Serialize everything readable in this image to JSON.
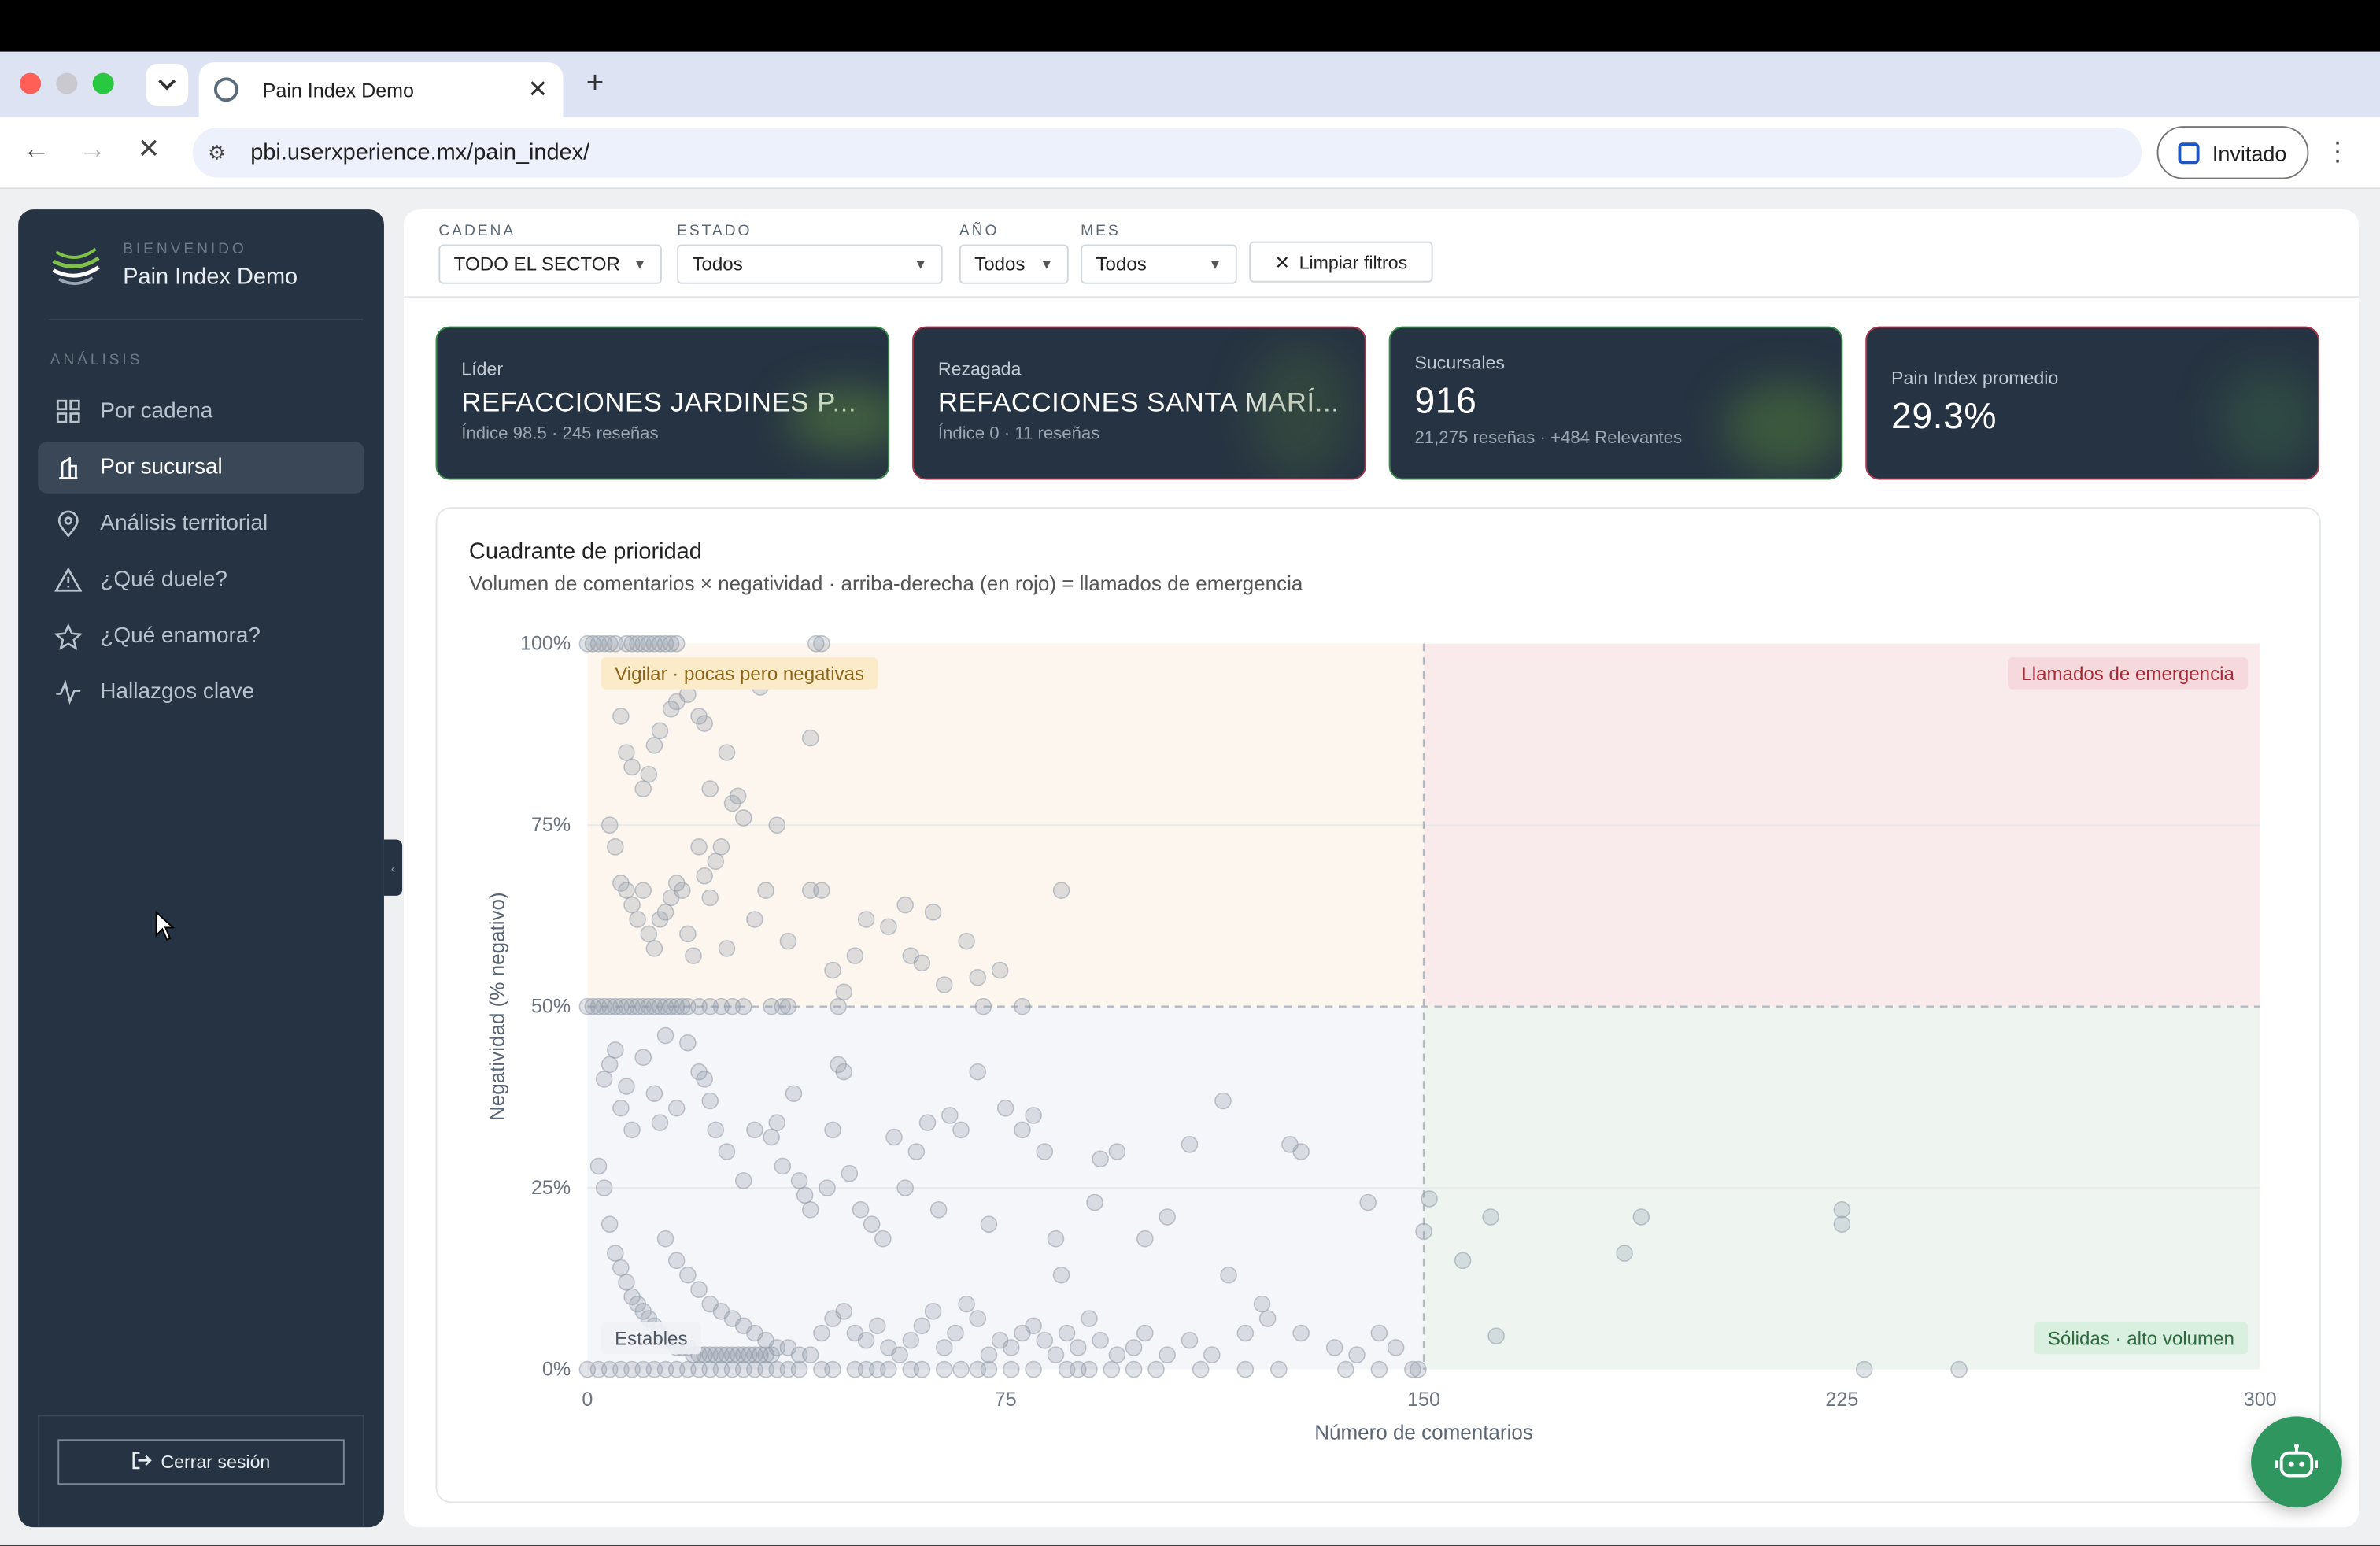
{
  "browser": {
    "tab_title": "Pain Index Demo",
    "url": "pbi.userxperience.mx/pain_index/",
    "profile_label": "Invitado"
  },
  "sidebar": {
    "welcome": "BIENVENIDO",
    "brand": "Pain Index Demo",
    "section": "ANÁLISIS",
    "items": [
      {
        "label": "Por cadena",
        "icon": "grid-icon"
      },
      {
        "label": "Por sucursal",
        "icon": "building-icon",
        "active": true
      },
      {
        "label": "Análisis territorial",
        "icon": "map-pin-icon"
      },
      {
        "label": "¿Qué duele?",
        "icon": "warning-icon"
      },
      {
        "label": "¿Qué enamora?",
        "icon": "star-icon"
      },
      {
        "label": "Hallazgos clave",
        "icon": "activity-icon"
      }
    ],
    "logout": "Cerrar sesión"
  },
  "filters": {
    "cadena": {
      "label": "CADENA",
      "value": "TODO EL SECTOR"
    },
    "estado": {
      "label": "ESTADO",
      "value": "Todos"
    },
    "anio": {
      "label": "AÑO",
      "value": "Todos"
    },
    "mes": {
      "label": "MES",
      "value": "Todos"
    },
    "clear": "Limpiar filtros"
  },
  "kpis": [
    {
      "label": "Líder",
      "value": "REFACCIONES JARDINES P...",
      "sub": "Índice 98.5 · 245 reseñas",
      "accent": "#3b8a4c"
    },
    {
      "label": "Rezagada",
      "value": "REFACCIONES SANTA MARÍ...",
      "sub": "Índice 0 · 11 reseñas",
      "accent": "#a3364a"
    },
    {
      "label": "Sucursales",
      "value": "916",
      "sub": "21,275 reseñas · +484 Relevantes",
      "accent": "#3b8a4c"
    },
    {
      "label": "Pain Index promedio",
      "value": "29.3%",
      "sub": "",
      "accent": "#a3364a"
    }
  ],
  "quadrant": {
    "title": "Cuadrante de prioridad",
    "subtitle": "Volumen de comentarios × negatividad · arriba-derecha (en rojo) = llamados de emergencia"
  },
  "chart_data": {
    "type": "scatter",
    "xlabel": "Número de comentarios",
    "ylabel": "Negatividad (% negativo)",
    "xlim": [
      0,
      300
    ],
    "ylim": [
      0,
      100
    ],
    "x_ticks": [
      "0",
      "75",
      "150",
      "225",
      "300"
    ],
    "y_ticks": [
      "0%",
      "25%",
      "50%",
      "75%",
      "100%"
    ],
    "thresholds": {
      "x": 150,
      "y": 50
    },
    "quadrant_labels": {
      "top_left": "Vigilar · pocas pero negativas",
      "top_right": "Llamados de emergencia",
      "bottom_left": "Estables",
      "bottom_right": "Sólidas · alto volumen"
    },
    "colors": {
      "top_left": "#fdf6ee",
      "top_right": "#f9ebec",
      "bottom_left": "#f4f6f9",
      "bottom_right": "#eef5f0",
      "point": "#8f9aa9"
    },
    "points": [
      [
        0,
        100
      ],
      [
        1,
        100
      ],
      [
        2,
        100
      ],
      [
        3,
        100
      ],
      [
        4,
        100
      ],
      [
        5,
        100
      ],
      [
        7,
        100
      ],
      [
        8,
        100
      ],
      [
        9,
        100
      ],
      [
        10,
        100
      ],
      [
        11,
        100
      ],
      [
        12,
        100
      ],
      [
        13,
        100
      ],
      [
        14,
        100
      ],
      [
        15,
        100
      ],
      [
        16,
        100
      ],
      [
        41,
        100
      ],
      [
        42,
        100
      ],
      [
        6,
        90
      ],
      [
        7,
        85
      ],
      [
        8,
        83
      ],
      [
        10,
        80
      ],
      [
        11,
        82
      ],
      [
        12,
        86
      ],
      [
        13,
        88
      ],
      [
        15,
        91
      ],
      [
        16,
        92
      ],
      [
        18,
        93
      ],
      [
        20,
        90
      ],
      [
        21,
        89
      ],
      [
        22,
        80
      ],
      [
        25,
        85
      ],
      [
        31,
        94
      ],
      [
        40,
        87
      ],
      [
        4,
        75
      ],
      [
        5,
        72
      ],
      [
        6,
        67
      ],
      [
        7,
        66
      ],
      [
        8,
        64
      ],
      [
        9,
        62
      ],
      [
        10,
        66
      ],
      [
        11,
        60
      ],
      [
        12,
        58
      ],
      [
        13,
        62
      ],
      [
        14,
        63
      ],
      [
        15,
        65
      ],
      [
        16,
        67
      ],
      [
        17,
        66
      ],
      [
        18,
        60
      ],
      [
        19,
        57
      ],
      [
        20,
        72
      ],
      [
        21,
        68
      ],
      [
        22,
        65
      ],
      [
        23,
        70
      ],
      [
        24,
        72
      ],
      [
        25,
        58
      ],
      [
        26,
        78
      ],
      [
        27,
        79
      ],
      [
        28,
        76
      ],
      [
        30,
        62
      ],
      [
        32,
        66
      ],
      [
        34,
        75
      ],
      [
        36,
        59
      ],
      [
        40,
        66
      ],
      [
        42,
        66
      ],
      [
        44,
        55
      ],
      [
        48,
        57
      ],
      [
        50,
        62
      ],
      [
        54,
        61
      ],
      [
        57,
        64
      ],
      [
        58,
        57
      ],
      [
        60,
        56
      ],
      [
        62,
        63
      ],
      [
        64,
        53
      ],
      [
        68,
        59
      ],
      [
        70,
        54
      ],
      [
        71,
        50
      ],
      [
        74,
        55
      ],
      [
        85,
        66
      ],
      [
        0,
        50
      ],
      [
        1,
        50
      ],
      [
        2,
        50
      ],
      [
        3,
        50
      ],
      [
        4,
        50
      ],
      [
        5,
        50
      ],
      [
        6,
        50
      ],
      [
        7,
        50
      ],
      [
        8,
        50
      ],
      [
        9,
        50
      ],
      [
        10,
        50
      ],
      [
        11,
        50
      ],
      [
        12,
        50
      ],
      [
        13,
        50
      ],
      [
        14,
        50
      ],
      [
        15,
        50
      ],
      [
        16,
        50
      ],
      [
        17,
        50
      ],
      [
        18,
        50
      ],
      [
        20,
        50
      ],
      [
        22,
        50
      ],
      [
        24,
        50
      ],
      [
        26,
        50
      ],
      [
        28,
        50
      ],
      [
        33,
        50
      ],
      [
        35,
        50
      ],
      [
        36,
        50
      ],
      [
        45,
        50
      ],
      [
        46,
        52
      ],
      [
        78,
        50
      ],
      [
        3,
        40
      ],
      [
        4,
        42
      ],
      [
        5,
        44
      ],
      [
        6,
        36
      ],
      [
        7,
        39
      ],
      [
        8,
        33
      ],
      [
        10,
        43
      ],
      [
        12,
        38
      ],
      [
        13,
        34
      ],
      [
        14,
        46
      ],
      [
        16,
        36
      ],
      [
        18,
        45
      ],
      [
        20,
        41
      ],
      [
        21,
        40
      ],
      [
        22,
        37
      ],
      [
        23,
        33
      ],
      [
        25,
        30
      ],
      [
        28,
        26
      ],
      [
        30,
        33
      ],
      [
        33,
        32
      ],
      [
        34,
        34
      ],
      [
        35,
        28
      ],
      [
        37,
        38
      ],
      [
        38,
        26
      ],
      [
        39,
        24
      ],
      [
        40,
        22
      ],
      [
        43,
        25
      ],
      [
        44,
        33
      ],
      [
        45,
        42
      ],
      [
        46,
        41
      ],
      [
        47,
        27
      ],
      [
        49,
        22
      ],
      [
        51,
        20
      ],
      [
        53,
        18
      ],
      [
        55,
        32
      ],
      [
        57,
        25
      ],
      [
        59,
        30
      ],
      [
        61,
        34
      ],
      [
        63,
        22
      ],
      [
        65,
        35
      ],
      [
        67,
        33
      ],
      [
        70,
        41
      ],
      [
        72,
        20
      ],
      [
        75,
        36
      ],
      [
        78,
        33
      ],
      [
        80,
        35
      ],
      [
        82,
        30
      ],
      [
        84,
        18
      ],
      [
        85,
        13
      ],
      [
        91,
        23
      ],
      [
        92,
        29
      ],
      [
        95,
        30
      ],
      [
        100,
        18
      ],
      [
        104,
        21
      ],
      [
        108,
        31
      ],
      [
        114,
        37
      ],
      [
        115,
        13
      ],
      [
        126,
        31
      ],
      [
        128,
        30
      ],
      [
        140,
        23
      ],
      [
        150,
        19
      ],
      [
        2,
        28
      ],
      [
        3,
        25
      ],
      [
        4,
        20
      ],
      [
        5,
        16
      ],
      [
        6,
        14
      ],
      [
        7,
        12
      ],
      [
        8,
        10
      ],
      [
        9,
        9
      ],
      [
        10,
        8
      ],
      [
        11,
        7
      ],
      [
        12,
        6
      ],
      [
        13,
        5
      ],
      [
        14,
        4
      ],
      [
        15,
        4
      ],
      [
        16,
        3
      ],
      [
        17,
        3
      ],
      [
        18,
        3
      ],
      [
        19,
        2
      ],
      [
        20,
        2
      ],
      [
        21,
        2
      ],
      [
        22,
        2
      ],
      [
        23,
        2
      ],
      [
        24,
        2
      ],
      [
        25,
        2
      ],
      [
        26,
        2
      ],
      [
        27,
        2
      ],
      [
        28,
        2
      ],
      [
        29,
        2
      ],
      [
        30,
        2
      ],
      [
        31,
        2
      ],
      [
        32,
        2
      ],
      [
        33,
        2
      ],
      [
        14,
        18
      ],
      [
        16,
        15
      ],
      [
        18,
        13
      ],
      [
        20,
        11
      ],
      [
        22,
        9
      ],
      [
        24,
        8
      ],
      [
        26,
        7
      ],
      [
        28,
        6
      ],
      [
        30,
        5
      ],
      [
        32,
        4
      ],
      [
        34,
        3
      ],
      [
        36,
        3
      ],
      [
        38,
        2
      ],
      [
        40,
        2
      ],
      [
        42,
        5
      ],
      [
        44,
        7
      ],
      [
        46,
        8
      ],
      [
        48,
        5
      ],
      [
        50,
        4
      ],
      [
        52,
        6
      ],
      [
        54,
        3
      ],
      [
        56,
        2
      ],
      [
        58,
        4
      ],
      [
        60,
        6
      ],
      [
        62,
        8
      ],
      [
        64,
        3
      ],
      [
        66,
        5
      ],
      [
        68,
        9
      ],
      [
        70,
        7
      ],
      [
        72,
        2
      ],
      [
        74,
        4
      ],
      [
        76,
        3
      ],
      [
        78,
        5
      ],
      [
        80,
        6
      ],
      [
        82,
        4
      ],
      [
        84,
        2
      ],
      [
        86,
        5
      ],
      [
        88,
        3
      ],
      [
        90,
        7
      ],
      [
        92,
        4
      ],
      [
        95,
        2
      ],
      [
        98,
        3
      ],
      [
        100,
        5
      ],
      [
        104,
        2
      ],
      [
        108,
        4
      ],
      [
        112,
        2
      ],
      [
        118,
        5
      ],
      [
        121,
        9
      ],
      [
        122,
        7
      ],
      [
        128,
        5
      ],
      [
        134,
        3
      ],
      [
        138,
        2
      ],
      [
        142,
        5
      ],
      [
        145,
        3
      ],
      [
        148,
        0
      ],
      [
        0,
        0
      ],
      [
        2,
        0
      ],
      [
        4,
        0
      ],
      [
        6,
        0
      ],
      [
        8,
        0
      ],
      [
        10,
        0
      ],
      [
        12,
        0
      ],
      [
        14,
        0
      ],
      [
        16,
        0
      ],
      [
        18,
        0
      ],
      [
        20,
        0
      ],
      [
        22,
        0
      ],
      [
        24,
        0
      ],
      [
        26,
        0
      ],
      [
        28,
        0
      ],
      [
        30,
        0
      ],
      [
        32,
        0
      ],
      [
        34,
        0
      ],
      [
        36,
        0
      ],
      [
        38,
        0
      ],
      [
        42,
        0
      ],
      [
        44,
        0
      ],
      [
        48,
        0
      ],
      [
        50,
        0
      ],
      [
        52,
        0
      ],
      [
        54,
        0
      ],
      [
        58,
        0
      ],
      [
        60,
        0
      ],
      [
        64,
        0
      ],
      [
        67,
        0
      ],
      [
        70,
        0
      ],
      [
        72,
        0
      ],
      [
        76,
        0
      ],
      [
        80,
        0
      ],
      [
        86,
        0
      ],
      [
        88,
        0
      ],
      [
        90,
        0
      ],
      [
        94,
        0
      ],
      [
        98,
        0
      ],
      [
        102,
        0
      ],
      [
        110,
        0
      ],
      [
        118,
        0
      ],
      [
        124,
        0
      ],
      [
        136,
        0
      ],
      [
        142,
        0
      ],
      [
        149,
        0
      ],
      [
        151,
        23.5
      ],
      [
        157,
        15
      ],
      [
        162,
        21
      ],
      [
        163,
        4.6
      ],
      [
        186,
        16
      ],
      [
        189,
        21
      ],
      [
        225,
        20
      ],
      [
        225,
        22
      ],
      [
        229,
        0
      ],
      [
        246,
        0
      ]
    ]
  }
}
